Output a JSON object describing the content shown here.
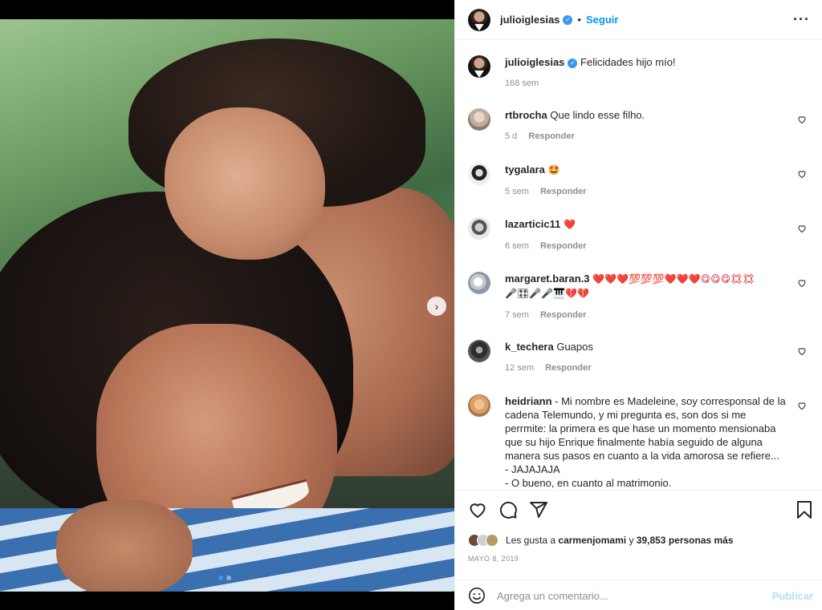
{
  "header": {
    "username": "julioiglesias",
    "separator": "•",
    "follow_label": "Seguir",
    "more_icon": "more-options-icon"
  },
  "caption": {
    "username": "julioiglesias",
    "text": "Felicidades hijo mío!",
    "time": "168 sem"
  },
  "comments": [
    {
      "username": "rtbrocha",
      "text": "Que lindo esse filho.",
      "time": "5 d",
      "reply": "Responder"
    },
    {
      "username": "tygalara",
      "text": "🤩",
      "time": "5 sem",
      "reply": "Responder"
    },
    {
      "username": "lazarticic11",
      "text": "❤️",
      "time": "6 sem",
      "reply": "Responder"
    },
    {
      "username": "margaret.baran.3",
      "text": "❤️❤️❤️💯💯💯❤️❤️❤️😋😋😋💢💢",
      "text2": "🎤🎛🎤🎤🎹💔💔",
      "time": "7 sem",
      "reply": "Responder"
    },
    {
      "username": "k_techera",
      "text": "Guapos",
      "time": "12 sem",
      "reply": "Responder"
    },
    {
      "username": "heidriann",
      "text": "- Mi nombre es Madeleine, soy corresponsal de la cadena Telemundo, y mi pregunta es, son dos si me perrmite: la primera es que hase un momento mensionaba que su hijo Enrique finalmente había seguido de alguna manera sus pasos en cuanto a la vida amorosa se refiere...",
      "line2": "- JAJAJAJA",
      "line3": "- O bueno, en cuanto al matrimonio."
    }
  ],
  "likes": {
    "prefix": "Les gusta a",
    "user": "carmenjomami",
    "middle": "y",
    "count": "39,853 personas más"
  },
  "date": "MAYO 8, 2019",
  "add_comment": {
    "placeholder": "Agrega un comentario...",
    "publish": "Publicar"
  },
  "carousel": {
    "total": 2,
    "current": 1
  }
}
